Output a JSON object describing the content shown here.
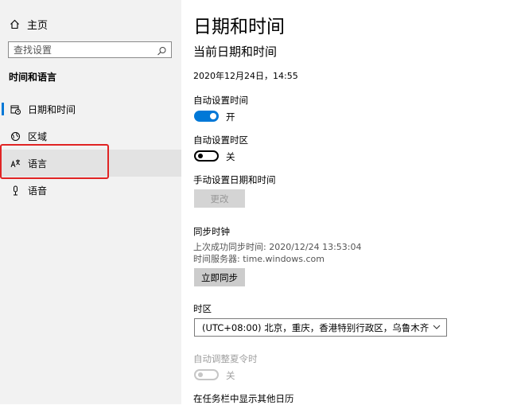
{
  "sidebar": {
    "home_label": "主页",
    "search_placeholder": "查找设置",
    "section_title": "时间和语言",
    "items": [
      {
        "label": "日期和时间",
        "icon": "calendar-clock-icon"
      },
      {
        "label": "区域",
        "icon": "globe-icon"
      },
      {
        "label": "语言",
        "icon": "language-icon"
      },
      {
        "label": "语音",
        "icon": "microphone-icon"
      }
    ]
  },
  "main": {
    "page_title": "日期和时间",
    "section_title": "当前日期和时间",
    "current_datetime": "2020年12月24日，14:55",
    "auto_time": {
      "label": "自动设置时间",
      "state": "开"
    },
    "auto_timezone": {
      "label": "自动设置时区",
      "state": "关"
    },
    "manual_set": {
      "label": "手动设置日期和时间",
      "button": "更改"
    },
    "sync": {
      "label": "同步时钟",
      "last_sync": "上次成功同步时间: 2020/12/24 13:53:04",
      "server": "时间服务器: time.windows.com",
      "button": "立即同步"
    },
    "timezone": {
      "label": "时区",
      "value": "(UTC+08:00) 北京，重庆，香港特别行政区，乌鲁木齐"
    },
    "dst": {
      "label": "自动调整夏令时",
      "state": "关"
    },
    "other_calendars": {
      "label": "在任务栏中显示其他日历"
    }
  },
  "colors": {
    "accent": "#0078d7",
    "highlight": "#e02424"
  }
}
